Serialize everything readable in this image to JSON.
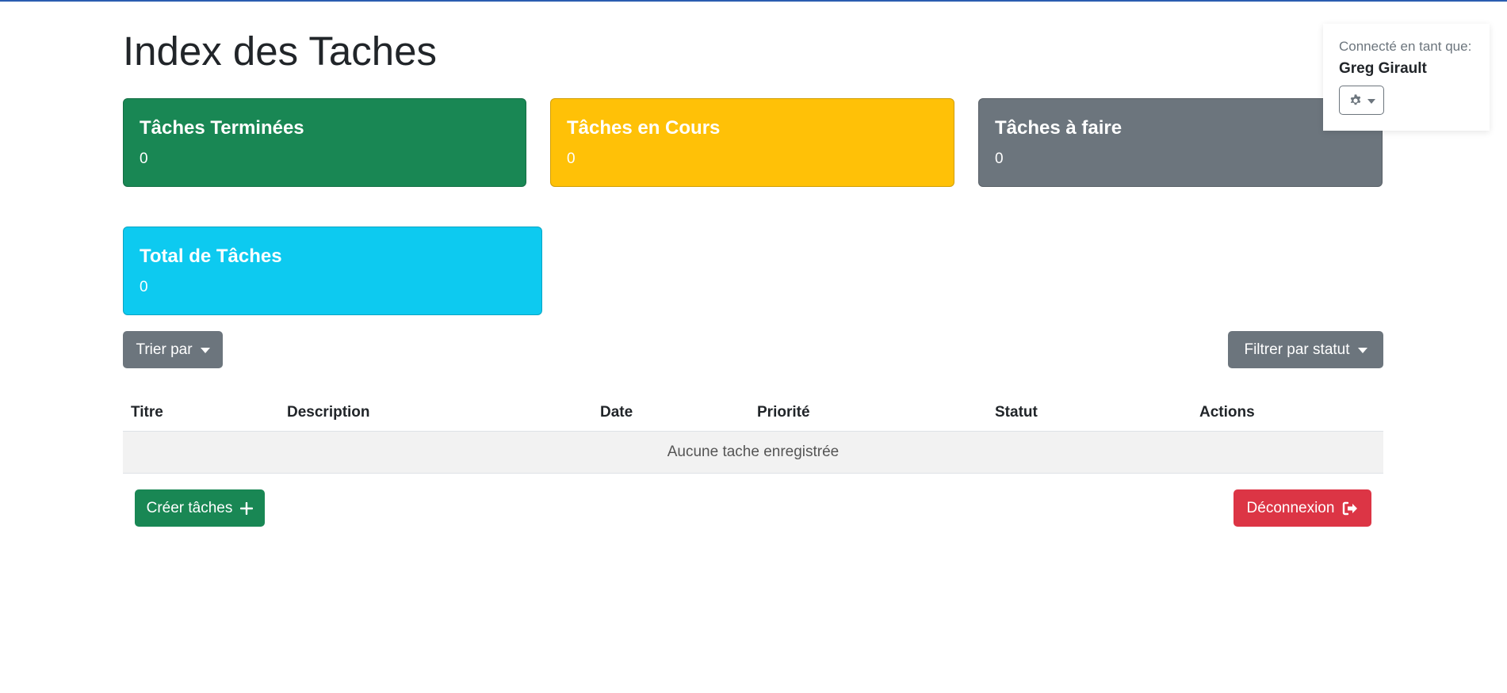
{
  "page": {
    "title": "Index des Taches"
  },
  "stats": {
    "done": {
      "label": "Tâches Terminées",
      "value": "0"
    },
    "in_progress": {
      "label": "Tâches en Cours",
      "value": "0"
    },
    "todo": {
      "label": "Tâches à faire",
      "value": "0"
    },
    "total": {
      "label": "Total de Tâches",
      "value": "0"
    }
  },
  "toolbar": {
    "sort_label": "Trier par",
    "filter_label": "Filtrer par statut"
  },
  "table": {
    "columns": [
      "Titre",
      "Description",
      "Date",
      "Priorité",
      "Statut",
      "Actions"
    ],
    "empty_message": "Aucune tache enregistrée"
  },
  "actions": {
    "create_label": "Créer tâches",
    "logout_label": "Déconnexion"
  },
  "user": {
    "label": "Connecté en tant que:",
    "name": "Greg Girault"
  },
  "icons": {
    "settings": "gear-icon",
    "create": "plus-icon",
    "logout": "sign-out-icon"
  },
  "colors": {
    "success": "#198754",
    "warning": "#ffc107",
    "secondary": "#6c757d",
    "info": "#0dcaf0",
    "danger": "#dc3545"
  }
}
